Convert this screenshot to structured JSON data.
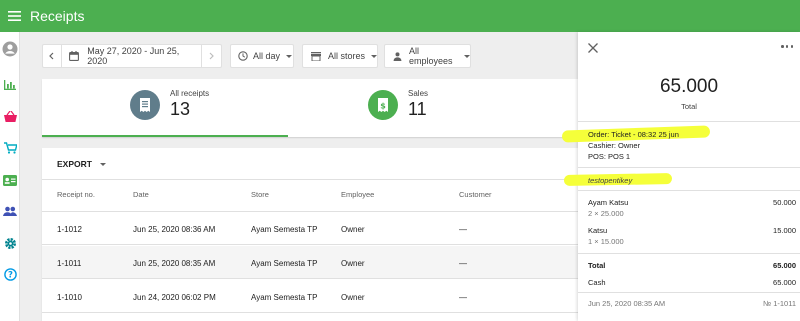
{
  "app": {
    "title": "Receipts"
  },
  "filters": {
    "date_range": "May 27, 2020 - Jun 25, 2020",
    "time": "All day",
    "stores": "All stores",
    "employees": "All employees"
  },
  "summary": [
    {
      "label": "All receipts",
      "value": "13",
      "icon": "receipt-icon",
      "color": "#607d8b"
    },
    {
      "label": "Sales",
      "value": "11",
      "icon": "sales-receipt-icon",
      "color": "#4caf50"
    }
  ],
  "table": {
    "export_label": "EXPORT",
    "columns": [
      "Receipt no.",
      "Date",
      "Store",
      "Employee",
      "Customer"
    ],
    "rows": [
      [
        "1-1012",
        "Jun 25, 2020 08:36 AM",
        "Ayam Semesta TP",
        "Owner",
        "—"
      ],
      [
        "1-1011",
        "Jun 25, 2020 08:35 AM",
        "Ayam Semesta TP",
        "Owner",
        "—"
      ],
      [
        "1-1010",
        "Jun 24, 2020 06:02 PM",
        "Ayam Semesta TP",
        "Owner",
        "—"
      ]
    ]
  },
  "panel": {
    "total": "65.000",
    "total_label": "Total",
    "order": "Order: Ticket - 08:32 25 jun",
    "cashier": "Cashier: Owner",
    "pos": "POS: POS 1",
    "comment": "testopentikey",
    "items": [
      {
        "name": "Ayam Katsu",
        "detail": "2 × 25.000",
        "amount": "50.000"
      },
      {
        "name": "Katsu",
        "detail": "1 × 15.000",
        "amount": "15.000"
      }
    ],
    "total_row_label": "Total",
    "total_row_value": "65.000",
    "payment_label": "Cash",
    "payment_value": "65.000",
    "date": "Jun 25, 2020 08:35 AM",
    "receipt_no": "№ 1-1011"
  },
  "colors": {
    "accent": "#4caf50",
    "highlight": "#f5ff3a",
    "sidebar_icon": "#4caf50"
  }
}
